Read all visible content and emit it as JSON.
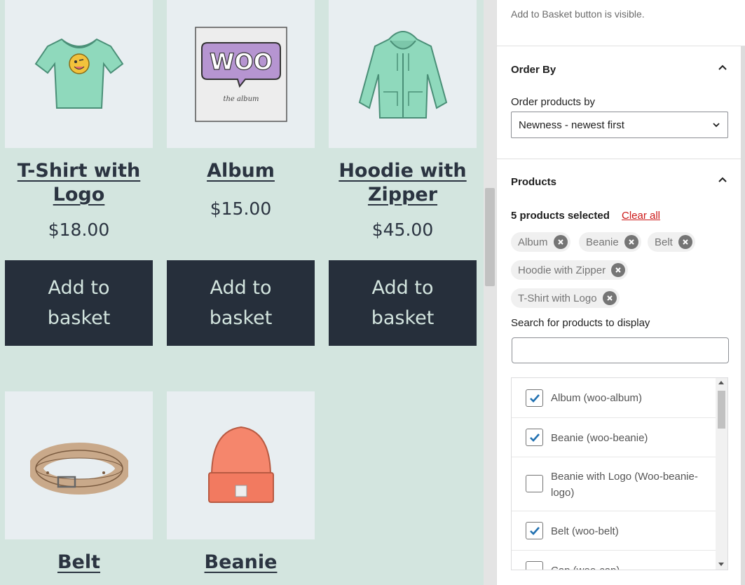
{
  "products": [
    {
      "title": "T-Shirt with Logo",
      "price": "$18.00",
      "button": "Add to basket",
      "icon": "tshirt-icon"
    },
    {
      "title": "Album",
      "price": "$15.00",
      "button": "Add to basket",
      "icon": "album-icon"
    },
    {
      "title": "Hoodie with Zipper",
      "price": "$45.00",
      "button": "Add to basket",
      "icon": "hoodie-icon"
    },
    {
      "title": "Belt",
      "icon": "belt-icon"
    },
    {
      "title": "Beanie",
      "icon": "beanie-icon"
    }
  ],
  "album_art": {
    "logo_text": "WOO",
    "caption": "the album"
  },
  "sidebar": {
    "help_text": "Add to Basket button is visible.",
    "order_by": {
      "panel_title": "Order By",
      "field_label": "Order products by",
      "selected": "Newness - newest first"
    },
    "products_panel": {
      "panel_title": "Products",
      "selected_count": "5 products selected",
      "clear_all": "Clear all",
      "chips": [
        "Album",
        "Beanie",
        "Belt",
        "Hoodie with Zipper",
        "T-Shirt with Logo"
      ],
      "search_label": "Search for products to display",
      "search_value": "",
      "list": [
        {
          "label": "Album (woo-album)",
          "checked": true
        },
        {
          "label": "Beanie (woo-beanie)",
          "checked": true
        },
        {
          "label": "Beanie with Logo (Woo-beanie-logo)",
          "checked": false
        },
        {
          "label": "Belt (woo-belt)",
          "checked": true
        },
        {
          "label": "Cap (woo-cap)",
          "checked": false
        }
      ]
    }
  },
  "colors": {
    "canvas_bg": "#d3e5df",
    "button_bg": "#262f3b",
    "checkbox_accent": "#2271b1",
    "clear_all": "#cc1818"
  }
}
